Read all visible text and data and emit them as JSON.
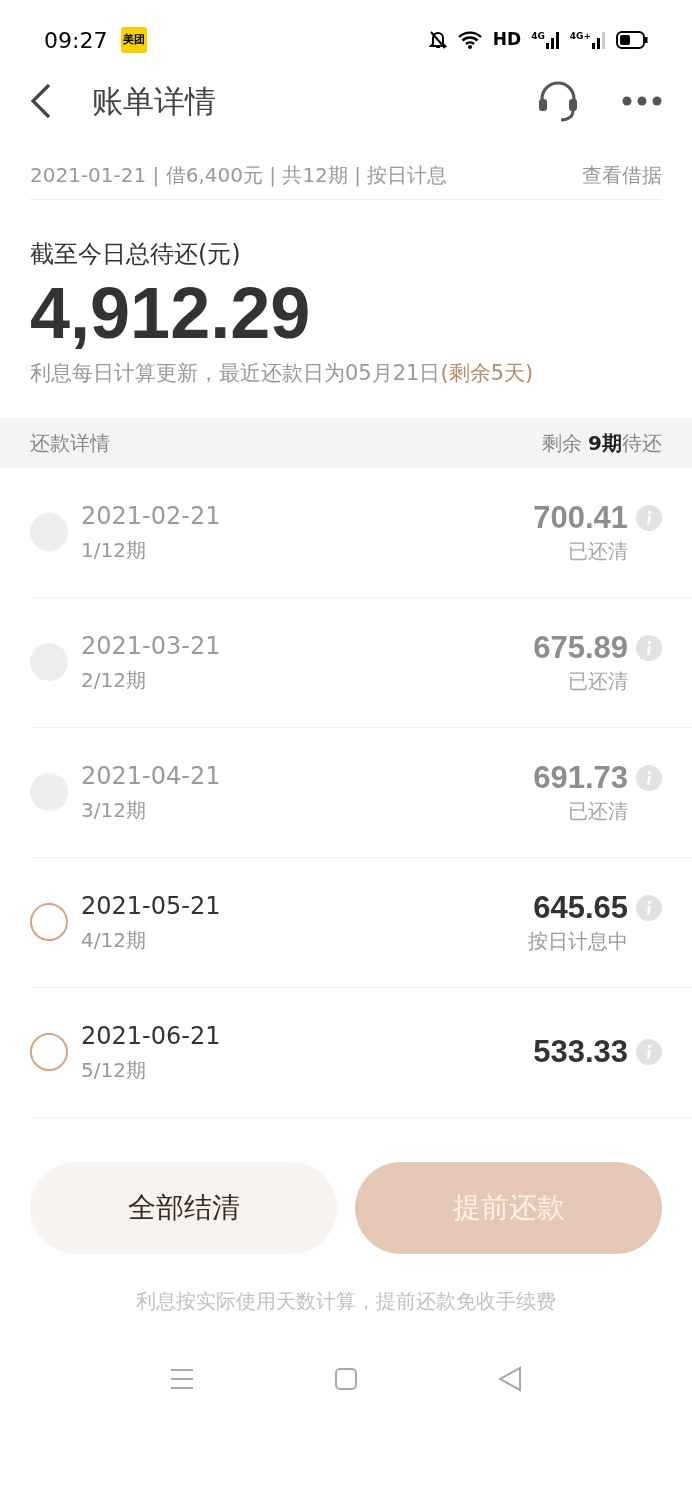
{
  "status_bar": {
    "time": "09:27",
    "app_badge": "美团",
    "hd": "HD",
    "network_1": "4G",
    "network_2": "4G+"
  },
  "header": {
    "title": "账单详情"
  },
  "loan_info": {
    "summary": "2021-01-21 | 借6,400元 | 共12期 | 按日计息",
    "link": "查看借据"
  },
  "balance": {
    "label": "截至今日总待还(元)",
    "amount": "4,912.29",
    "note": "利息每日计算更新，最近还款日为05月21日",
    "note_highlight": "(剩余5天)"
  },
  "schedule_header": {
    "title": "还款详情",
    "remaining_prefix": "剩余 ",
    "remaining_count": "9期",
    "remaining_suffix": "待还"
  },
  "installments": [
    {
      "kind": "paid",
      "date": "2021-02-21",
      "period": "1/12期",
      "amount": "700.41",
      "status": "已还清"
    },
    {
      "kind": "paid",
      "date": "2021-03-21",
      "period": "2/12期",
      "amount": "675.89",
      "status": "已还清"
    },
    {
      "kind": "paid",
      "date": "2021-04-21",
      "period": "3/12期",
      "amount": "691.73",
      "status": "已还清"
    },
    {
      "kind": "current",
      "date": "2021-05-21",
      "period": "4/12期",
      "amount": "645.65",
      "status": "按日计息中"
    },
    {
      "kind": "upcoming",
      "date": "2021-06-21",
      "period": "5/12期",
      "amount": "533.33"
    }
  ],
  "buttons": [
    {
      "label": "全部结清",
      "kind": "secondary"
    },
    {
      "label": "提前还款",
      "kind": "primary"
    }
  ],
  "footnote": "利息按实际使用天数计算，提前还款免收手续费"
}
